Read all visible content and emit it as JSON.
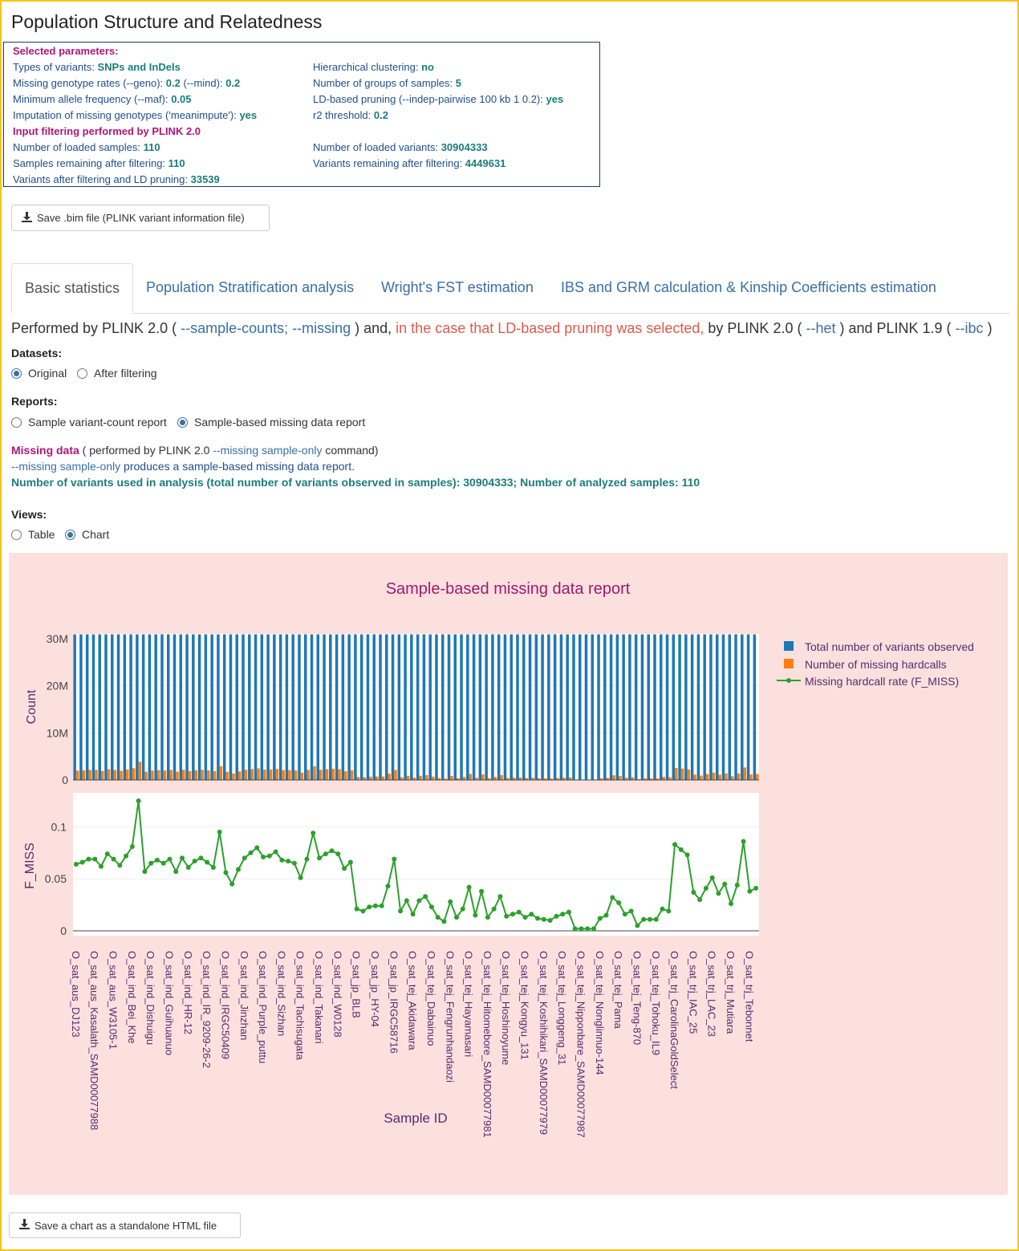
{
  "title": "Population Structure and Relatedness",
  "params": {
    "selected_header": "Selected parameters:",
    "left": [
      {
        "label": "Types of variants: ",
        "value": "SNPs and InDels"
      },
      {
        "label": "Missing genotype rates (--geno): ",
        "value": "0.2",
        "label2": " (--mind): ",
        "value2": "0.2"
      },
      {
        "label": "Minimum allele frequency (--maf): ",
        "value": "0.05"
      },
      {
        "label": "Imputation of missing genotypes ('meanimpute'): ",
        "value": "yes"
      }
    ],
    "right": [
      {
        "label": "Hierarchical clustering: ",
        "value": "no"
      },
      {
        "label": "Number of groups of samples: ",
        "value": "5"
      },
      {
        "label": "LD-based pruning (--indep-pairwise 100 kb 1 0.2): ",
        "value": "yes"
      },
      {
        "label": "r2 threshold: ",
        "value": "0.2"
      }
    ],
    "filter_header": "Input filtering performed by PLINK 2.0",
    "filter_left": [
      {
        "label": "Number of loaded samples: ",
        "value": "110"
      },
      {
        "label": "Samples remaining after filtering: ",
        "value": "110"
      },
      {
        "label": "Variants after filtering and LD pruning: ",
        "value": "33539"
      }
    ],
    "filter_right": [
      {
        "label": "Number of loaded variants: ",
        "value": "30904333"
      },
      {
        "label": "Variants remaining after filtering: ",
        "value": "4449631"
      }
    ]
  },
  "save_bim_label": "Save .bim file (PLINK variant information file)",
  "tabs": [
    "Basic statistics",
    "Population Stratification analysis",
    "Wright's FST estimation",
    "IBS and GRM calculation & Kinship Coefficients estimation"
  ],
  "performed": {
    "p1": "Performed by PLINK 2.0 ( ",
    "l1": "--sample-counts; --missing",
    "p2": " ) and, ",
    "red": "in the case that LD-based pruning was selected,",
    "p3": " by PLINK 2.0 ( ",
    "l2": "--het",
    "p4": " ) and PLINK 1.9 ( ",
    "l3": "--ibc",
    "p5": " )"
  },
  "datasets": {
    "label": "Datasets:",
    "options": [
      "Original",
      "After filtering"
    ],
    "selected": 0
  },
  "reports": {
    "label": "Reports:",
    "options": [
      "Sample variant-count report",
      "Sample-based missing data report"
    ],
    "selected": 1
  },
  "missing": {
    "title": "Missing data",
    "t1": " ( performed by PLINK 2.0 ",
    "cmd": "--missing sample-only",
    "t2": " command)",
    "l2_cmd": "--missing sample-only",
    "l2_text": " produces a sample-based missing data report.",
    "summary": "Number of variants used in analysis (total number of variants observed in samples): 30904333; Number of analyzed samples: 110"
  },
  "views": {
    "label": "Views:",
    "options": [
      "Table",
      "Chart"
    ],
    "selected": 1
  },
  "save_chart_label": "Save a chart as a standalone HTML file",
  "colors": {
    "blue": "#1f77b4",
    "orange": "#ff7f0e",
    "green": "#2ca02c",
    "chart_bg": "#fbe0de",
    "title": "#9e1a6e"
  },
  "chart_data": {
    "type": "bar",
    "title": "Sample-based missing data report",
    "xlabel": "Sample ID",
    "ylabel_top": "Count",
    "ylabel_bottom": "F_MISS",
    "ylim_top": [
      0,
      31000000
    ],
    "ylim_bottom": [
      0,
      0.125
    ],
    "top_ticks": [
      "0",
      "10M",
      "20M",
      "30M"
    ],
    "bottom_ticks": [
      "0",
      "0.05",
      "0.1"
    ],
    "legend": [
      "Total number of variants observed",
      "Number of missing hardcalls",
      "Missing hardcall rate (F_MISS)"
    ],
    "x_labels": [
      "O_sat_aus_DJ123",
      "O_sat_aus_Kasalath_SAMD00077988",
      "O_sat_aus_W3105-1",
      "O_sat_ind_Bei_Khe",
      "O_sat_ind_Dishuigu",
      "O_sat_ind_Guihuanuo",
      "O_sat_ind_HR-12",
      "O_sat_ind_IR_9209-26-2",
      "O_sat_ind_IRGC50409",
      "O_sat_ind_Jinzhan",
      "O_sat_ind_Purple_puttu",
      "O_sat_ind_Sizhan",
      "O_sat_ind_Tachisugata",
      "O_sat_ind_Takanari",
      "O_sat_ind_W0128",
      "O_sat_jp_BLB",
      "O_sat_jp_HY-04",
      "O_sat_jp_IRGC58716",
      "O_sat_tej_Akidawara",
      "O_sat_tej_Dabainuo",
      "O_sat_tej_Fengrunhandaozi",
      "O_sat_tej_Hayamasari",
      "O_sat_tej_Hitomebore_SAMD00077981",
      "O_sat_tej_Hoshinoyume",
      "O_sat_tej_Kongyu_131",
      "O_sat_tej_Koshihikari_SAMD00077979",
      "O_sat_tej_Longgeng_31",
      "O_sat_tej_Nipponbare_SAMD00077987",
      "O_sat_tej_Nonglinnuo-144",
      "O_sat_tej_Pama",
      "O_sat_tej_Teng-870",
      "O_sat_tej_Tohoku_IL9",
      "O_sat_trj_CarolinaGoldSelect",
      "O_sat_trj_IAC_25",
      "O_sat_trj_LAC_23",
      "O_sat_trj_Mutiara",
      "O_sat_trj_Tebonnet"
    ],
    "total_observed_each": 30904333,
    "f_miss": [
      0.064,
      0.066,
      0.069,
      0.069,
      0.062,
      0.074,
      0.069,
      0.063,
      0.072,
      0.081,
      0.125,
      0.057,
      0.065,
      0.068,
      0.065,
      0.069,
      0.057,
      0.07,
      0.061,
      0.067,
      0.07,
      0.066,
      0.061,
      0.095,
      0.056,
      0.045,
      0.059,
      0.07,
      0.075,
      0.08,
      0.071,
      0.072,
      0.076,
      0.068,
      0.067,
      0.065,
      0.051,
      0.069,
      0.094,
      0.07,
      0.074,
      0.077,
      0.074,
      0.06,
      0.066,
      0.021,
      0.019,
      0.023,
      0.024,
      0.024,
      0.043,
      0.069,
      0.019,
      0.029,
      0.016,
      0.029,
      0.033,
      0.023,
      0.013,
      0.009,
      0.028,
      0.013,
      0.021,
      0.042,
      0.015,
      0.038,
      0.013,
      0.021,
      0.033,
      0.014,
      0.016,
      0.018,
      0.013,
      0.016,
      0.012,
      0.011,
      0.01,
      0.014,
      0.016,
      0.018,
      0.002,
      0.002,
      0.002,
      0.002,
      0.012,
      0.015,
      0.032,
      0.027,
      0.016,
      0.019,
      0.005,
      0.011,
      0.011,
      0.011,
      0.021,
      0.019,
      0.083,
      0.078,
      0.073,
      0.037,
      0.03,
      0.041,
      0.051,
      0.036,
      0.045,
      0.026,
      0.044,
      0.086,
      0.038,
      0.041
    ]
  }
}
